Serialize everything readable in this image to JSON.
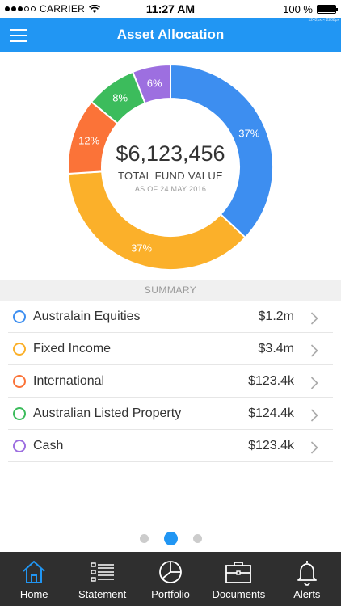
{
  "status_bar": {
    "carrier": "CARRIER",
    "time": "11:27 AM",
    "battery": "100 %",
    "battery_level": 1.0
  },
  "header": {
    "title": "Asset Allocation",
    "dimension_tag": "1242px × 2208px"
  },
  "fund": {
    "value": "$6,123,456",
    "label": "TOTAL FUND VALUE",
    "as_of": "AS OF 24 MAY 2016"
  },
  "chart_data": {
    "type": "pie",
    "donut": true,
    "slices": [
      {
        "label": "Australain Equities",
        "value": 37,
        "display": "37%",
        "color": "#3d8ef0"
      },
      {
        "label": "Fixed Income",
        "value": 37,
        "display": "37%",
        "color": "#fbb02a"
      },
      {
        "label": "International",
        "value": 12,
        "display": "12%",
        "color": "#fb7338"
      },
      {
        "label": "Australian Listed Property",
        "value": 8,
        "display": "8%",
        "color": "#3cbc5c"
      },
      {
        "label": "Cash",
        "value": 6,
        "display": "6%",
        "color": "#9d6fe0"
      }
    ]
  },
  "summary": {
    "title": "SUMMARY",
    "rows": [
      {
        "label": "Australain Equities",
        "value": "$1.2m",
        "color": "#3d8ef0"
      },
      {
        "label": "Fixed Income",
        "value": "$3.4m",
        "color": "#fbb02a"
      },
      {
        "label": "International",
        "value": "$123.4k",
        "color": "#fb7338"
      },
      {
        "label": "Australian Listed Property",
        "value": "$124.4k",
        "color": "#3cbc5c"
      },
      {
        "label": "Cash",
        "value": "$123.4k",
        "color": "#9d6fe0"
      }
    ]
  },
  "pager": {
    "count": 3,
    "active": 2
  },
  "tabs": [
    {
      "label": "Home",
      "icon": "home-icon",
      "active": true
    },
    {
      "label": "Statement",
      "icon": "list-icon",
      "active": false
    },
    {
      "label": "Portfolio",
      "icon": "pie-chart-icon",
      "active": false
    },
    {
      "label": "Documents",
      "icon": "briefcase-icon",
      "active": false
    },
    {
      "label": "Alerts",
      "icon": "bell-icon",
      "active": false
    }
  ]
}
